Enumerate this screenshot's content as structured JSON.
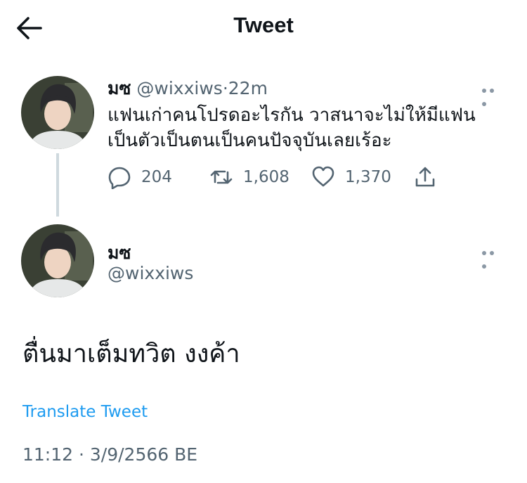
{
  "header": {
    "title": "Tweet",
    "back_icon": "arrow-left-icon"
  },
  "parent_tweet": {
    "name": "มซ",
    "handle": "@wixxiws",
    "separator": "·",
    "time": "22m",
    "text_line1": "แฟนเก่าคนโปรดอะไรกัน วาสนาจะไม่ให้มีแฟน",
    "text_line2": "เป็นตัวเป็นตนเป็นคนปัจจุบันเลยเร้อะ",
    "replies": "204",
    "retweets": "1,608",
    "likes": "1,370"
  },
  "main_tweet": {
    "name": "มซ",
    "handle": "@wixxiws",
    "text": "ตื่นมาเต็มทวิต งงค้า",
    "translate_label": "Translate Tweet",
    "timestamp": "11:12 · 3/9/2566 BE"
  },
  "colors": {
    "text": "#0f1419",
    "muted": "#536471",
    "link": "#1d9bf0",
    "thread_line": "#cfd9de"
  }
}
